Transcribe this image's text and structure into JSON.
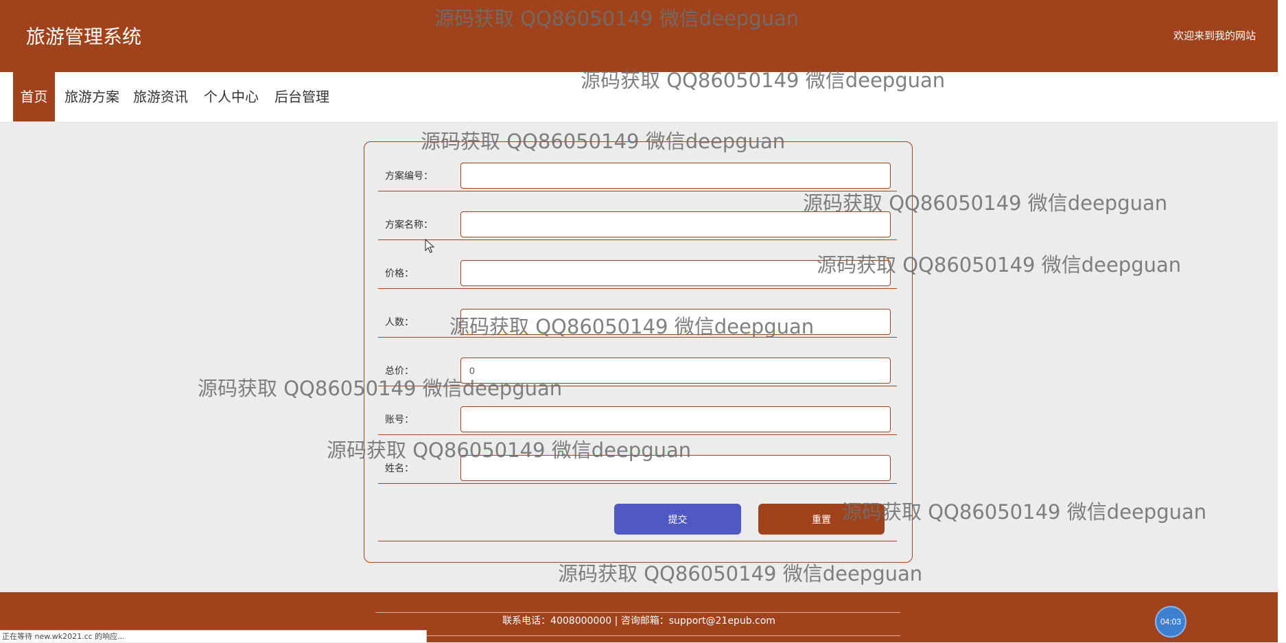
{
  "header": {
    "site_title": "旅游管理系统",
    "welcome_text": "欢迎来到我的网站"
  },
  "nav": {
    "items": [
      {
        "label": "首页",
        "active": true
      },
      {
        "label": "旅游方案",
        "active": false
      },
      {
        "label": "旅游资讯",
        "active": false
      },
      {
        "label": "个人中心",
        "active": false
      },
      {
        "label": "后台管理",
        "active": false
      }
    ]
  },
  "form": {
    "fields": [
      {
        "label": "方案编号：",
        "value": ""
      },
      {
        "label": "方案名称：",
        "value": ""
      },
      {
        "label": "价格：",
        "value": ""
      },
      {
        "label": "人数：",
        "value": ""
      },
      {
        "label": "总价：",
        "value": "0"
      },
      {
        "label": "账号：",
        "value": ""
      },
      {
        "label": "姓名：",
        "value": ""
      }
    ],
    "submit_label": "提交",
    "reset_label": "重置"
  },
  "footer": {
    "contact": "联系电话：4008000000 | 咨询邮箱：support@21epub.com"
  },
  "clock": {
    "time": "04:03"
  },
  "status_bar": {
    "text": "正在等待 new.wk2021.cc 的响应..."
  },
  "watermark": {
    "text": "源码获取 QQ86050149 微信deepguan"
  },
  "colors": {
    "brand": "#a0421b",
    "submit": "#5059c3",
    "background": "#ececec"
  }
}
